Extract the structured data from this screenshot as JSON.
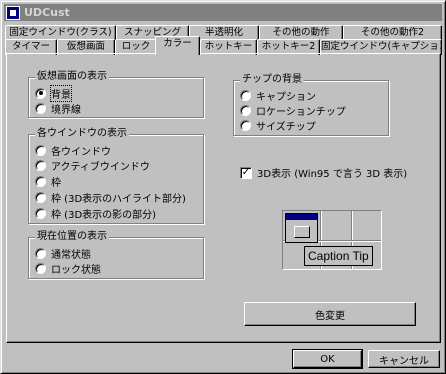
{
  "window": {
    "title": "UDCust"
  },
  "tabs_row1": [
    {
      "label": "固定ウインドウ(クラス)"
    },
    {
      "label": "スナッピング"
    },
    {
      "label": "半透明化"
    },
    {
      "label": "その他の動作"
    },
    {
      "label": "その他の動作2"
    }
  ],
  "tabs_row2": [
    {
      "label": "タイマー"
    },
    {
      "label": "仮想画面"
    },
    {
      "label": "ロック"
    },
    {
      "label": "カラー",
      "active": true
    },
    {
      "label": "ホットキー"
    },
    {
      "label": "ホットキー2"
    },
    {
      "label": "固定ウインドウ(キャプション)"
    }
  ],
  "virtual_screen": {
    "title": "仮想画面の表示",
    "options": [
      {
        "label": "背景",
        "selected": true
      },
      {
        "label": "境界線",
        "selected": false
      }
    ]
  },
  "window_display": {
    "title": "各ウインドウの表示",
    "options": [
      {
        "label": "各ウインドウ",
        "selected": false
      },
      {
        "label": "アクティブウインドウ",
        "selected": false
      },
      {
        "label": "枠",
        "selected": false
      },
      {
        "label": "枠 (3D表示のハイライト部分)",
        "selected": false
      },
      {
        "label": "枠 (3D表示の影の部分)",
        "selected": false
      }
    ]
  },
  "current_position": {
    "title": "現在位置の表示",
    "options": [
      {
        "label": "通常状態",
        "selected": false
      },
      {
        "label": "ロック状態",
        "selected": false
      }
    ]
  },
  "chip_background": {
    "title": "チップの背景",
    "options": [
      {
        "label": "キャプション",
        "selected": false
      },
      {
        "label": "ロケーションチップ",
        "selected": false
      },
      {
        "label": "サイズチップ",
        "selected": false
      }
    ]
  },
  "three_d": {
    "label": "3D表示 (Win95 で言う 3D 表示)",
    "checked": true
  },
  "preview": {
    "tip_text": "Caption Tip"
  },
  "buttons": {
    "change_color": "色変更",
    "ok": "OK",
    "cancel": "キャンセル"
  },
  "colors": {
    "titlebar_inactive": "#808080",
    "face": "#c0c0c0",
    "mini_title": "#000080"
  }
}
